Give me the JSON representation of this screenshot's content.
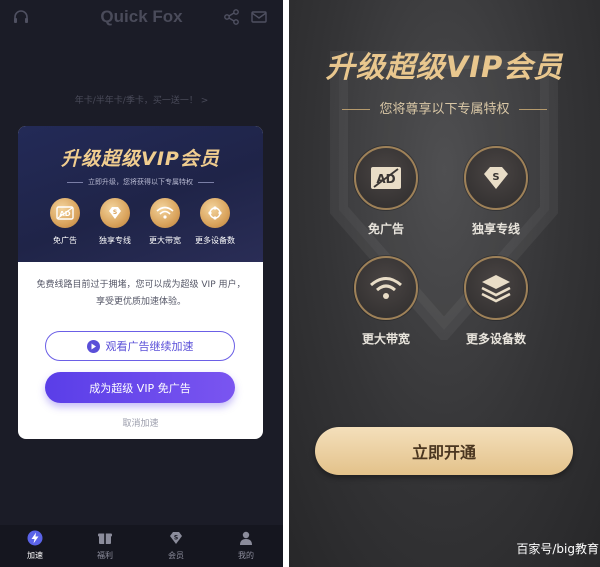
{
  "left": {
    "app_title": "Quick Fox",
    "promo": "年卡/半年卡/季卡，买一送一！ >",
    "modal": {
      "title": "升级超级VIP会员",
      "subtitle": "立即升级，您将获得以下专属特权",
      "features": [
        {
          "label": "免广告",
          "icon": "ad-icon"
        },
        {
          "label": "独享专线",
          "icon": "diamond-icon"
        },
        {
          "label": "更大带宽",
          "icon": "wifi-icon"
        },
        {
          "label": "更多设备数",
          "icon": "devices-icon"
        }
      ],
      "message": "免费线路目前过于拥堵，您可以成为超级 VIP 用户，享受更优质加速体验。",
      "watch_ad_label": "观看广告继续加速",
      "become_vip_label": "成为超级 VIP 免广告",
      "cancel_label": "取消加速"
    },
    "tabs": [
      {
        "label": "加速",
        "icon": "lightning-icon",
        "active": true
      },
      {
        "label": "福利",
        "icon": "gift-icon",
        "active": false
      },
      {
        "label": "会员",
        "icon": "diamond-icon",
        "active": false
      },
      {
        "label": "我的",
        "icon": "person-icon",
        "active": false
      }
    ]
  },
  "right": {
    "title": "升级超级VIP会员",
    "subtitle": "您将尊享以下专属特权",
    "features": [
      {
        "label": "免广告",
        "icon": "ad-icon"
      },
      {
        "label": "独享专线",
        "icon": "diamond-icon"
      },
      {
        "label": "更大带宽",
        "icon": "wifi-icon"
      },
      {
        "label": "更多设备数",
        "icon": "layers-icon"
      }
    ],
    "open_button_label": "立即开通",
    "watermark": "百家号/big教育"
  },
  "colors": {
    "gold": "#e9c78e",
    "purple": "#5a4fd8",
    "dark_bg": "#1b1c27"
  }
}
